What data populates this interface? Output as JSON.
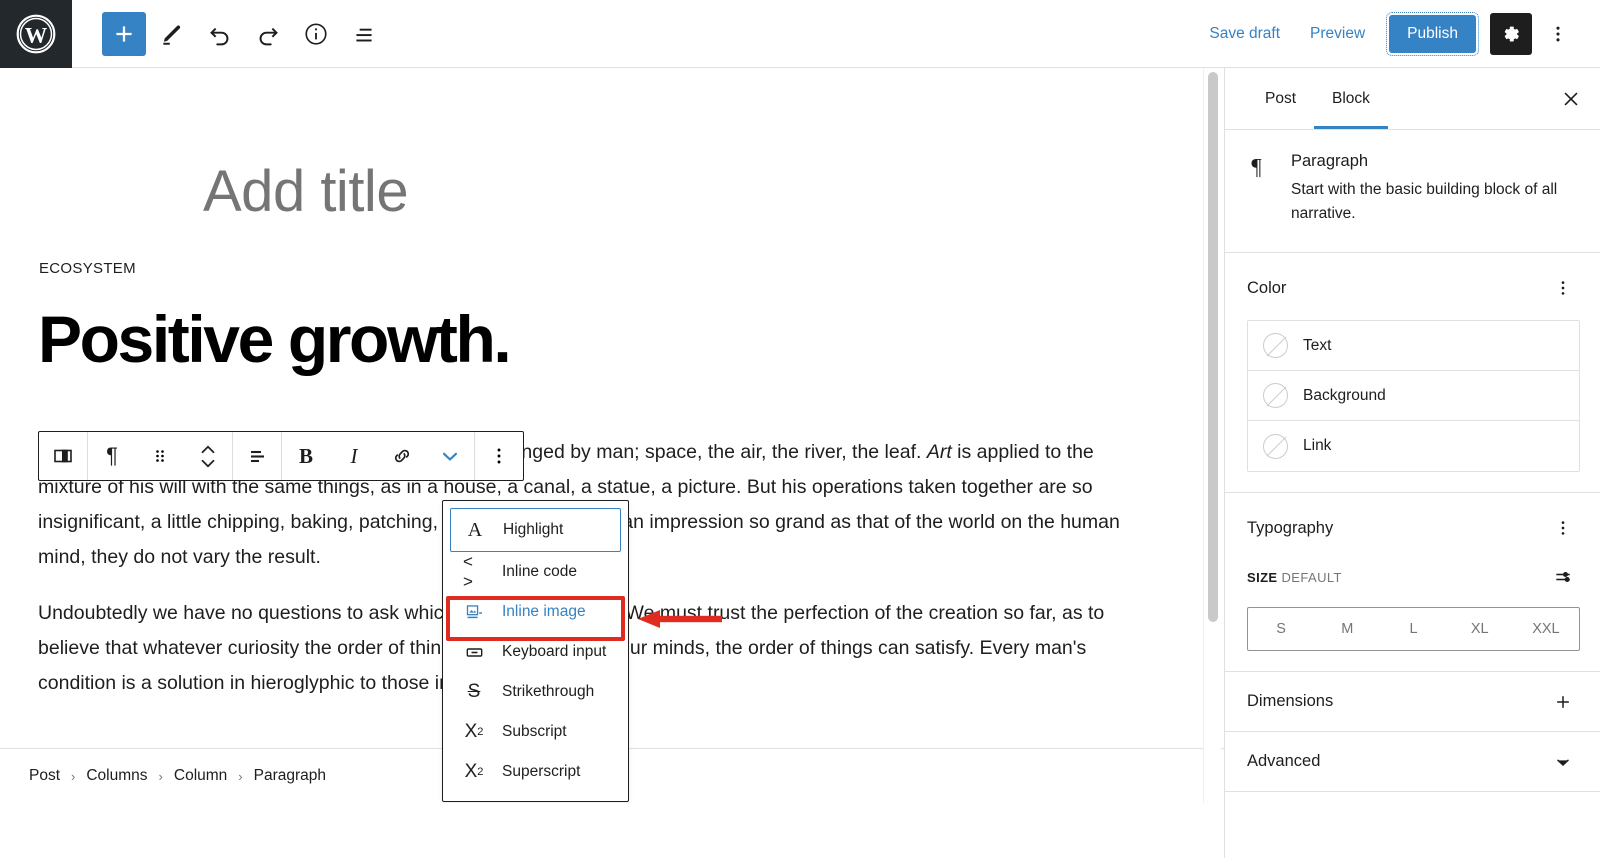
{
  "theme": {
    "accent": "#3582c4",
    "dark": "#1e1e1e",
    "annotation_red": "#e02b20",
    "muted": "#757575",
    "border": "#e0e0e0"
  },
  "topbar": {
    "logo_name": "wordpress-logo",
    "tools": [
      {
        "name": "add-block-button",
        "icon": "plus-icon",
        "label": "Toggle block inserter"
      },
      {
        "name": "tools-button",
        "icon": "pencil-icon",
        "label": "Tools"
      },
      {
        "name": "undo-button",
        "icon": "undo-arrow-icon",
        "label": "Undo"
      },
      {
        "name": "redo-button",
        "icon": "redo-arrow-icon",
        "label": "Redo"
      },
      {
        "name": "details-button",
        "icon": "info-circle-icon",
        "label": "Details"
      },
      {
        "name": "list-view-button",
        "icon": "list-view-icon",
        "label": "List view"
      }
    ],
    "save_draft_label": "Save draft",
    "preview_label": "Preview",
    "publish_label": "Publish",
    "settings_icon": "gear-icon",
    "more_icon": "vertical-dots-icon"
  },
  "editor": {
    "title_placeholder": "Add title",
    "eyebrow": "ECOSYSTEM",
    "heading": "Positive growth.",
    "paragraph_1_html": "<em>Nature</em>, in the common sense, refers to essences unchanged by man; space, the air, the river, the leaf. <em>Art</em> is applied to the mixture of his will with the same things, as in a house, a canal, a statue, a picture. But his operations taken together are so insignificant, a little chipping, baking, patching, and washing, that in an impression so grand as that of the world on the human mind, they do not vary the result.",
    "paragraph_2_html": "Undoubtedly we have no questions to ask which are unanswerable. We must trust the perfection of the creation so far, as to believe that whatever curiosity the order of things has awakened in our minds, the order of things can satisfy. Every man's condition is a solution in hieroglyphic to those inquiries he would put."
  },
  "block_toolbar": {
    "buttons": [
      {
        "name": "block-type-columns-button",
        "icon": "columns-icon"
      },
      {
        "name": "block-type-paragraph-button",
        "icon": "paragraph-pilcrow-icon",
        "glyph": "¶"
      },
      {
        "name": "drag-handle",
        "icon": "drag-dots-icon"
      },
      {
        "name": "move-block-button",
        "icon": "up-down-chevrons-icon"
      },
      {
        "name": "align-text-button",
        "icon": "align-text-icon"
      },
      {
        "name": "bold-button",
        "icon": "bold-icon",
        "glyph": "B"
      },
      {
        "name": "italic-button",
        "icon": "italic-icon",
        "glyph": "I"
      },
      {
        "name": "link-button",
        "icon": "link-icon"
      },
      {
        "name": "more-formatting-button",
        "icon": "chevron-down-icon"
      },
      {
        "name": "block-options-button",
        "icon": "vertical-dots-icon"
      }
    ]
  },
  "dropdown": {
    "items": [
      {
        "label": "Highlight",
        "icon": "highlight-letter-a-icon",
        "glyph": "A",
        "state": "focused"
      },
      {
        "label": "Inline code",
        "icon": "angle-brackets-icon",
        "glyph": "< >",
        "state": "normal"
      },
      {
        "label": "Inline image",
        "icon": "inline-image-icon",
        "glyph": "",
        "state": "highlighted"
      },
      {
        "label": "Keyboard input",
        "icon": "keyboard-key-icon",
        "glyph": "",
        "state": "normal"
      },
      {
        "label": "Strikethrough",
        "icon": "strikethrough-s-icon",
        "glyph": "S",
        "state": "normal"
      },
      {
        "label": "Subscript",
        "icon": "subscript-x2-icon",
        "glyph": "X",
        "state": "normal"
      },
      {
        "label": "Superscript",
        "icon": "superscript-x2-icon",
        "glyph": "X",
        "state": "normal"
      }
    ],
    "annotation": {
      "target_label": "Inline image",
      "box_color": "#e02b20",
      "arrow_direction": "left",
      "arrow_color": "#e02b20"
    }
  },
  "breadcrumb": {
    "separator": "›",
    "items": [
      "Post",
      "Columns",
      "Column",
      "Paragraph"
    ]
  },
  "sidebar": {
    "tabs": [
      {
        "label": "Post",
        "active": false
      },
      {
        "label": "Block",
        "active": true
      }
    ],
    "close_icon": "close-x-icon",
    "block_card": {
      "icon": "paragraph-pilcrow-icon",
      "glyph": "¶",
      "title": "Paragraph",
      "description": "Start with the basic building block of all narrative."
    },
    "color": {
      "title": "Color",
      "options_icon": "vertical-dots-icon",
      "rows": [
        {
          "label": "Text",
          "value": "none"
        },
        {
          "label": "Background",
          "value": "none"
        },
        {
          "label": "Link",
          "value": "none"
        }
      ]
    },
    "typography": {
      "title": "Typography",
      "options_icon": "vertical-dots-icon",
      "size_key": "SIZE",
      "size_value": "DEFAULT",
      "settings_icon": "sliders-icon",
      "size_buttons": [
        "S",
        "M",
        "L",
        "XL",
        "XXL"
      ]
    },
    "dimensions": {
      "title": "Dimensions",
      "icon": "plus-icon"
    },
    "advanced": {
      "title": "Advanced",
      "icon": "chevron-down-icon"
    }
  }
}
